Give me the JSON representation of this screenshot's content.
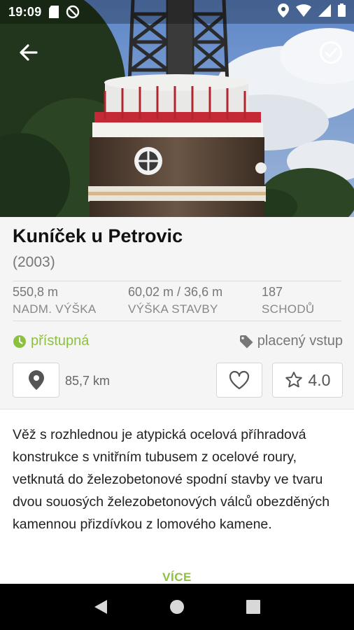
{
  "status_bar": {
    "time": "19:09",
    "icons_left": [
      "sd-card-icon",
      "do-not-disturb-icon"
    ],
    "icons_right": [
      "location-icon",
      "wifi-icon",
      "signal-icon",
      "battery-icon"
    ]
  },
  "header": {
    "back_icon": "arrow-left-icon",
    "visited_icon": "check-circle-icon"
  },
  "tower": {
    "name": "Kuníček u Petrovic",
    "year": "(2003)",
    "stats": [
      {
        "value": "550,8 m",
        "label": "NADM. VÝŠKA"
      },
      {
        "value": "60,02 m / 36,6 m",
        "label": "VÝŠKA STAVBY"
      },
      {
        "value": "187",
        "label": "SCHODŮ"
      }
    ],
    "access": "přístupná",
    "fee": "placený vstup",
    "distance": "85,7 km",
    "rating": "4.0",
    "description": "Věž s rozhlednou je atypická ocelová příhradová konstrukce s vnitřním tubusem z ocelové roury, vetknutá do železobetonové spodní stavby ve tvaru dvou souosých železobetonových válců obezděných kamennou přizdívkou z lomového kamene.",
    "more_label": "VÍCE"
  },
  "colors": {
    "accent_green": "#8cc13f",
    "text_gray": "#777777",
    "nav_bar": "#000000"
  }
}
